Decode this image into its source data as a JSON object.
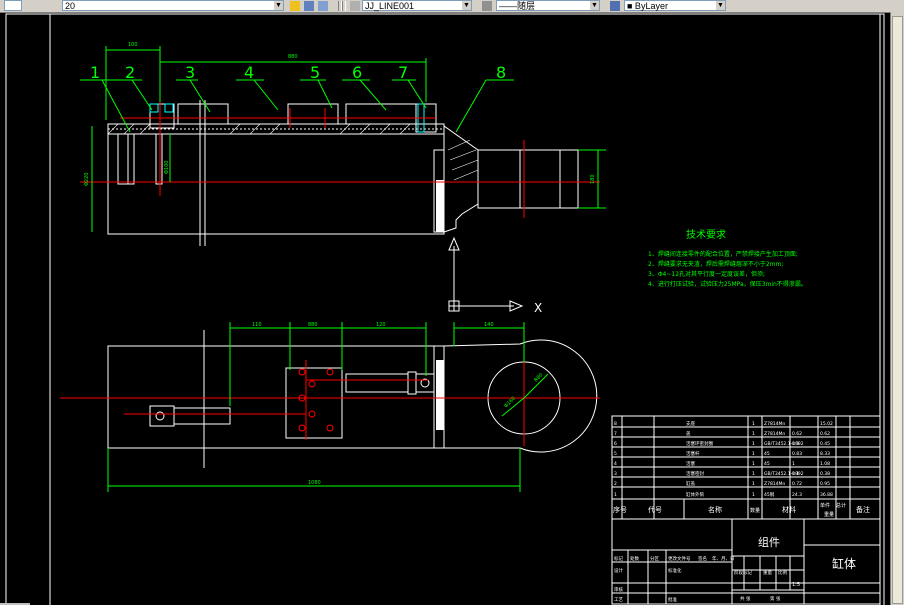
{
  "toolbar": {
    "layer_combo": "20",
    "style_combo": "JJ_LINE001",
    "lineweight_combo": "——随层",
    "color_combo": "■ ByLayer"
  },
  "balloons": [
    "1",
    "2",
    "3",
    "4",
    "5",
    "6",
    "7",
    "8"
  ],
  "dims": {
    "top_short": "100",
    "top_long": "880",
    "bore_dia": "Φ220",
    "rod_dia": "Φ100",
    "eye_h": "180",
    "plan_a": "110",
    "plan_b": "880",
    "plan_c": "120",
    "plan_d": "140",
    "eye_r": "R80",
    "eye_dia": "Φ160",
    "overall": "1080"
  },
  "tech_notes": {
    "title": "技术要求",
    "lines": [
      "1、焊缝间连接零件的配合位置，严禁焊接产生加工顶面;",
      "2、焊缝要求无夹渣，焊后需焊缝熔深不小于2mm;",
      "3、Φ4~12孔对其平行度一定度误差，但须;",
      "4、进行打压试验，试验压力25MPa，保压3min不得渗漏。"
    ]
  },
  "axis": {
    "x_label": "X"
  },
  "bom": {
    "rows": [
      {
        "no": "8",
        "name": "支座",
        "qty": "1",
        "material": "Z7814Mn",
        "w": "",
        "w2": "15.02"
      },
      {
        "no": "7",
        "name": "盖",
        "qty": "1",
        "material": "Z7814Mn",
        "w": "0.62",
        "w2": "0.62"
      },
      {
        "no": "6",
        "name": "活塞环密封圈",
        "qty": "1",
        "material": "GB/T3452.1-1992",
        "w": "0.5",
        "w2": "0.45"
      },
      {
        "no": "5",
        "name": "活塞杆",
        "qty": "1",
        "material": "45",
        "w": "0.83",
        "w2": "8.33"
      },
      {
        "no": "4",
        "name": "活塞",
        "qty": "1",
        "material": "45",
        "w": "1",
        "w2": "1.08"
      },
      {
        "no": "3",
        "name": "活塞密封",
        "qty": "1",
        "material": "GB/T3452.1-1992",
        "w": "0.1",
        "w2": "0.38"
      },
      {
        "no": "2",
        "name": "缸盖",
        "qty": "1",
        "material": "Z7814Mn",
        "w": "0.72",
        "w2": "0.95"
      },
      {
        "no": "1",
        "name": "缸体外筒",
        "qty": "1",
        "material": "45钢",
        "w": "24.3",
        "w2": "36.88"
      }
    ],
    "header": {
      "seq": "序号",
      "code": "代号",
      "name": "名称",
      "qty": "数量",
      "material": "材料",
      "single_weight": "单件",
      "total_weight": "总计",
      "weight": "重量",
      "remark": "备注"
    },
    "assembly": "组件",
    "part_name": "缸体",
    "scale": "1:5",
    "labels": [
      "标记",
      "处数",
      "分区",
      "更改文件号",
      "签名",
      "年、月、日",
      "设计",
      "标准化",
      "审核",
      "工艺",
      "批准",
      "阶段标记",
      "重量",
      "比例",
      "共 张",
      "第 张"
    ]
  },
  "colors": {
    "white": "#ffffff",
    "green": "#00ff00",
    "red": "#ff0000",
    "cyan": "#00ffff",
    "yellow": "#ffff00",
    "magenta": "#ff00ff"
  }
}
